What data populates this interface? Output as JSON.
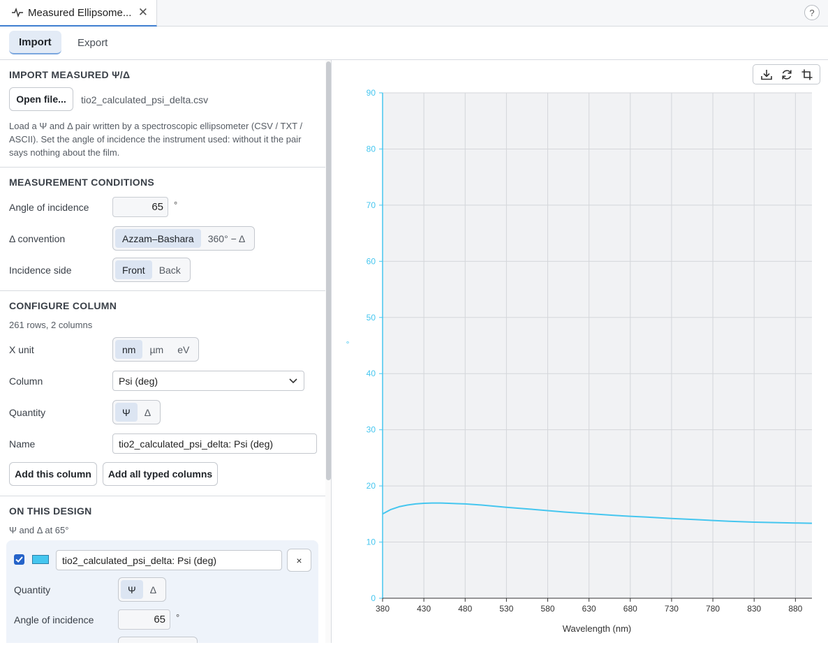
{
  "tab": {
    "title": "Measured Ellipsome...",
    "icon": "waveform-icon",
    "close": "✕"
  },
  "help": {
    "label": "?"
  },
  "subtabs": [
    {
      "label": "Import",
      "active": true
    },
    {
      "label": "Export",
      "active": false
    }
  ],
  "import": {
    "title": "IMPORT MEASURED Ψ/Δ",
    "open_button": "Open file...",
    "filename": "tio2_calculated_psi_delta.csv",
    "help": "Load a Ψ and Δ pair written by a spectroscopic ellipsometer (CSV / TXT / ASCII). Set the angle of incidence the instrument used: without it the pair says nothing about the film."
  },
  "conditions": {
    "title": "MEASUREMENT CONDITIONS",
    "aoi_label": "Angle of incidence",
    "aoi_value": "65",
    "aoi_unit": "°",
    "delta_label": "Δ convention",
    "delta_options": [
      "Azzam–Bashara",
      "360° − Δ"
    ],
    "delta_selected": "Azzam–Bashara",
    "side_label": "Incidence side",
    "side_options": [
      "Front",
      "Back"
    ],
    "side_selected": "Front"
  },
  "configure": {
    "title": "CONFIGURE COLUMN",
    "summary": "261 rows, 2 columns",
    "xunit_label": "X unit",
    "xunit_options": [
      "nm",
      "µm",
      "eV"
    ],
    "xunit_selected": "nm",
    "column_label": "Column",
    "column_value": "Psi (deg)",
    "quantity_label": "Quantity",
    "quantity_options": [
      "Ψ",
      "Δ"
    ],
    "quantity_selected": "Ψ",
    "name_label": "Name",
    "name_value": "tio2_calculated_psi_delta: Psi (deg)",
    "add_button": "Add this column",
    "add_all_button": "Add all typed columns"
  },
  "design": {
    "title": "ON THIS DESIGN",
    "subtitle": "Ψ and Δ at 65°",
    "item": {
      "checked": true,
      "color": "#45c6ef",
      "name": "tio2_calculated_psi_delta: Psi (deg)",
      "remove": "×",
      "quantity_label": "Quantity",
      "quantity_options": [
        "Ψ",
        "Δ"
      ],
      "quantity_selected": "Ψ",
      "aoi_label": "Angle of incidence",
      "aoi_value": "65",
      "aoi_unit": "°"
    }
  },
  "toolbar": {
    "icons": [
      "download-icon",
      "refresh-icon",
      "crop-icon"
    ]
  },
  "chart_data": {
    "type": "line",
    "title": "",
    "xlabel": "Wavelength (nm)",
    "ylabel": "°",
    "xlim": [
      380,
      900
    ],
    "ylim": [
      0,
      90
    ],
    "xticks": [
      380,
      430,
      480,
      530,
      580,
      630,
      680,
      730,
      780,
      830,
      880
    ],
    "yticks": [
      0,
      10,
      20,
      30,
      40,
      50,
      60,
      70,
      80,
      90
    ],
    "grid": true,
    "series": [
      {
        "color": "#45c6ef",
        "x": [
          380,
          390,
          400,
          410,
          420,
          430,
          440,
          450,
          460,
          470,
          480,
          500,
          530,
          560,
          580,
          600,
          630,
          660,
          680,
          700,
          730,
          760,
          780,
          800,
          830,
          860,
          880,
          900
        ],
        "y": [
          15.0,
          15.8,
          16.3,
          16.6,
          16.8,
          16.9,
          16.95,
          16.95,
          16.9,
          16.85,
          16.8,
          16.6,
          16.2,
          15.85,
          15.6,
          15.35,
          15.05,
          14.75,
          14.6,
          14.45,
          14.2,
          14.0,
          13.85,
          13.7,
          13.55,
          13.45,
          13.4,
          13.35
        ]
      }
    ]
  }
}
